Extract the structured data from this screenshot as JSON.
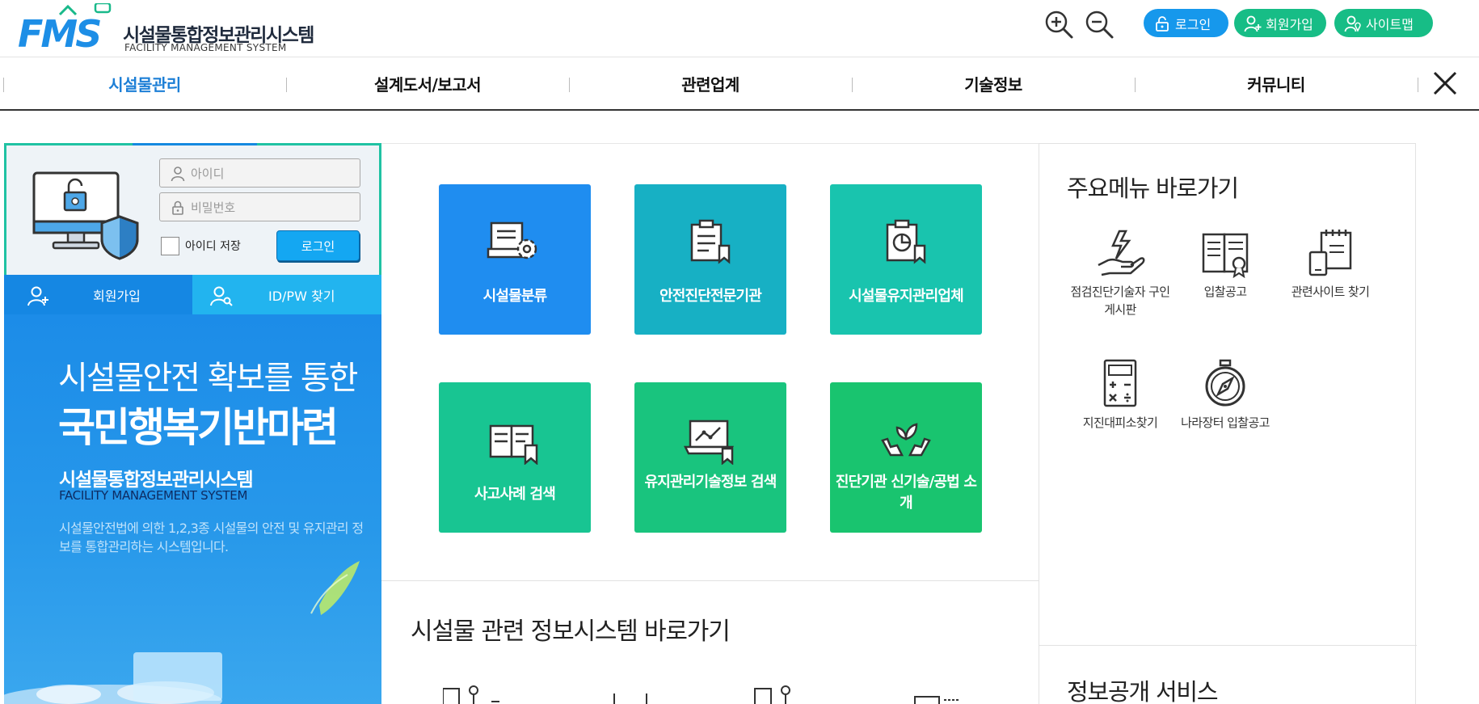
{
  "header": {
    "logo_mark": "FMS",
    "logo_name": "시설물통합정보관리시스템",
    "logo_sub": "FACILITY MANAGEMENT SYSTEM",
    "login_label": "로그인",
    "join_label": "회원가입",
    "sitemap_label": "사이트맵"
  },
  "nav": {
    "items": [
      "시설물관리",
      "설계도서/보고서",
      "관련업계",
      "기술정보",
      "커뮤니티"
    ],
    "active_index": 0
  },
  "login_panel": {
    "id_placeholder": "아이디",
    "pw_placeholder": "비밀번호",
    "remember_label": "아이디 저장",
    "login_button": "로그인",
    "join_button": "회원가입",
    "find_button": "ID/PW 찾기"
  },
  "banner": {
    "line1": "시설물안전 확보를 통한",
    "line2": "국민행복기반마련",
    "line3": "시설물통합정보관리시스템",
    "line4": "FACILITY MANAGEMENT SYSTEM",
    "line5": "시설물안전법에 의한 1,2,3종 시설물의 안전 및 유지관리 정보를 통합관리하는 시스템입니다."
  },
  "tiles": [
    {
      "label": "시설물분류",
      "icon": "document-gear-icon",
      "color": "#1f8df0"
    },
    {
      "label": "안전진단전문기관",
      "icon": "clipboard-icon",
      "color": "#17b0c4"
    },
    {
      "label": "시설물유지관리업체",
      "icon": "clipboard-chart-icon",
      "color": "#19c4ae"
    },
    {
      "label": "사고사례 검색",
      "icon": "book-icon",
      "color": "#18c592"
    },
    {
      "label": "유지관리기술정보 검색",
      "icon": "laptop-chart-icon",
      "color": "#19c47e"
    },
    {
      "label": "진단기관 신기술/공법 소개",
      "icon": "hands-plant-icon",
      "color": "#19c46f"
    }
  ],
  "center": {
    "section_title": "시설물 관련 정보시스템 바로가기"
  },
  "right": {
    "title": "주요메뉴 바로가기",
    "links": [
      {
        "label": "점검진단기술자 구인게시판",
        "icon": "hand-lightning-icon"
      },
      {
        "label": "입찰공고",
        "icon": "open-book-icon"
      },
      {
        "label": "관련사이트 찾기",
        "icon": "notepad-phone-icon"
      },
      {
        "label": "지진대피소찾기",
        "icon": "calculator-icon"
      },
      {
        "label": "나라장터 입찰공고",
        "icon": "compass-icon"
      }
    ],
    "title2": "정보공개 서비스"
  },
  "colors": {
    "primary_blue": "#1698ec",
    "green": "#17bd86",
    "active_nav": "#1d7fd6",
    "panel_border": "#20c2a3"
  }
}
